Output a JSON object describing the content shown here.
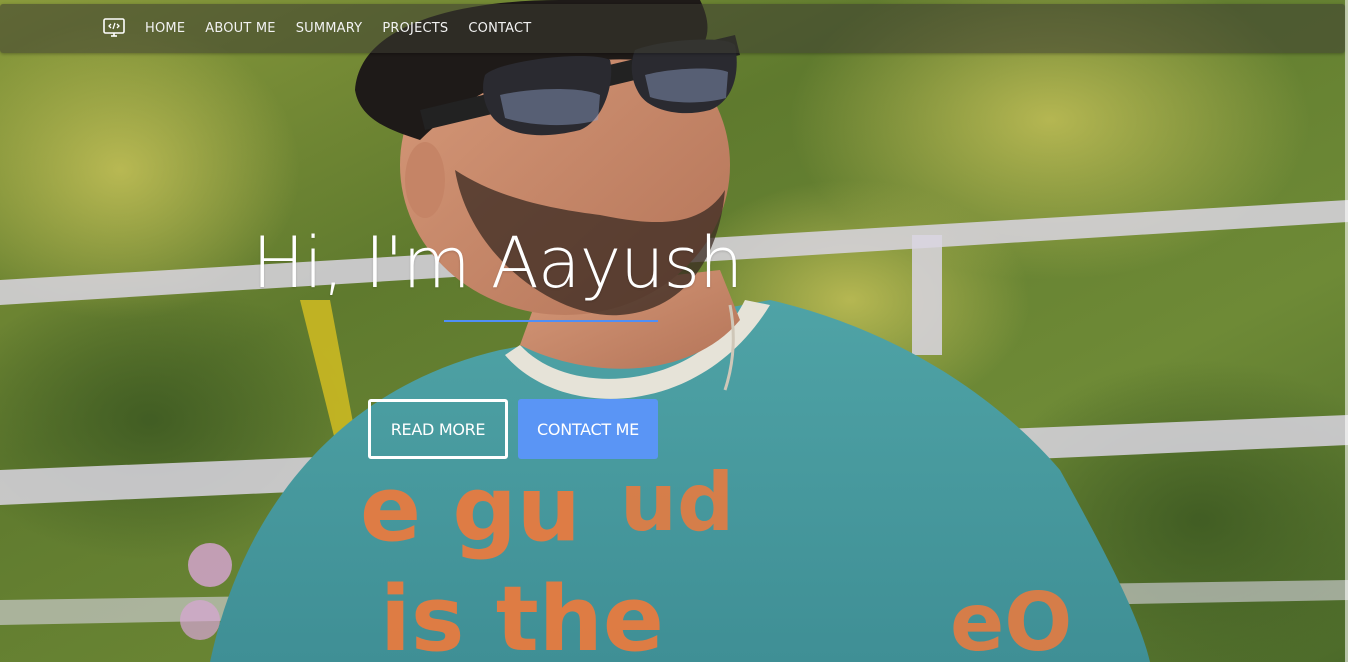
{
  "nav": {
    "logo_icon": "monitor-code-icon",
    "items": [
      {
        "label": "HOME"
      },
      {
        "label": "ABOUT ME"
      },
      {
        "label": "SUMMARY"
      },
      {
        "label": "PROJECTS"
      },
      {
        "label": "CONTACT"
      }
    ]
  },
  "hero": {
    "title": "Hi, I'm Aayush",
    "read_more_label": "READ MORE",
    "contact_label": "CONTACT ME",
    "background_image": "portrait-photo"
  },
  "colors": {
    "accent": "#5a95f5",
    "underline": "#4f8ff7",
    "nav_bg": "rgba(60,60,50,0.55)",
    "text": "#ffffff"
  }
}
